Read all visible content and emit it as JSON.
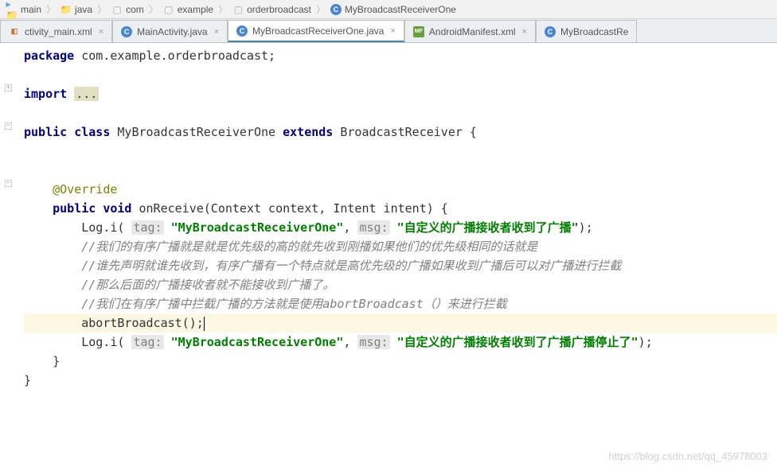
{
  "breadcrumb": {
    "items": [
      {
        "icon": "folder",
        "label": "main"
      },
      {
        "icon": "folder",
        "label": "java"
      },
      {
        "icon": "pkg",
        "label": "com"
      },
      {
        "icon": "pkg",
        "label": "example"
      },
      {
        "icon": "pkg",
        "label": "orderbroadcast"
      },
      {
        "icon": "class",
        "label": "MyBroadcastReceiverOne"
      }
    ]
  },
  "tabs": {
    "items": [
      {
        "icon": "xml",
        "label": "ctivity_main.xml",
        "active": false
      },
      {
        "icon": "c",
        "label": "MainActivity.java",
        "active": false
      },
      {
        "icon": "c",
        "label": "MyBroadcastReceiverOne.java",
        "active": true
      },
      {
        "icon": "mf",
        "label": "AndroidManifest.xml",
        "active": false
      },
      {
        "icon": "c",
        "label": "MyBroadcastRe",
        "active": false
      }
    ],
    "close_glyph": "×"
  },
  "code": {
    "package_kw": "package",
    "package_stmt": " com.example.orderbroadcast;",
    "import_kw": "import",
    "ellipsis": "...",
    "public_kw": "public",
    "class_kw": "class",
    "class_name": " MyBroadcastReceiverOne ",
    "extends_kw": "extends",
    "extends_name": " BroadcastReceiver {",
    "override": "@Override",
    "void_kw": "void",
    "method_sig": " onReceive(Context context, Intent intent) {",
    "log1_pre": "Log.i( ",
    "tag_hint": "tag:",
    "tag_str": "\"MyBroadcastReceiverOne\"",
    "comma": ", ",
    "msg_hint": "msg:",
    "msg1_str": "\"自定义的广播接收者收到了广播\"",
    "close_paren": ");",
    "cmt1": "//我们的有序广播就是就是优先级的高的就先收到刚播如果他们的优先级相同的话就是",
    "cmt2": "//谁先声明就谁先收到，有序广播有一个特点就是高优先级的广播如果收到广播后可以对广播进行拦截",
    "cmt3": "//那么后面的广播接收者就不能接收到广播了。",
    "cmt4": "//我们在有序广播中拦截广播的方法就是使用abortBroadcast（）来进行拦截",
    "abort": "abortBroadcast();",
    "log2_pre": "Log.i( ",
    "msg2_str": "\"自定义的广播接收者收到了广播广播停止了\"",
    "brace": "}",
    "brace2": "}"
  },
  "watermark": "https://blog.csdn.net/qq_45978003"
}
